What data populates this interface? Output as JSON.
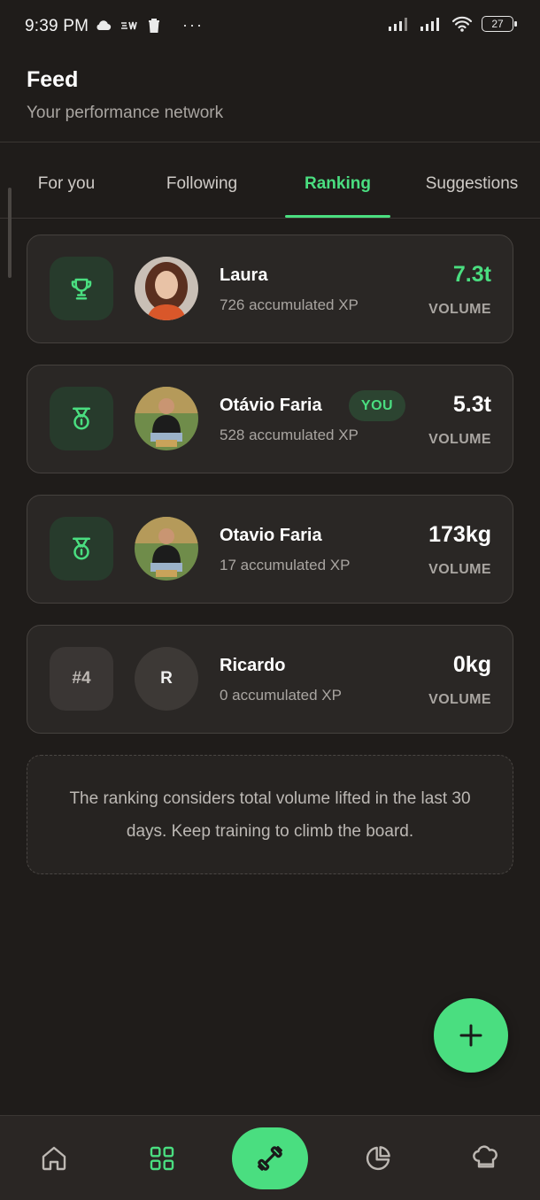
{
  "status_bar": {
    "time": "9:39 PM",
    "battery": "27",
    "dots": "···",
    "icons": [
      "cloud-icon",
      "notification-app-icon",
      "trash-icon",
      "cell-signal-icon",
      "cell-signal-icon",
      "wifi-icon",
      "battery-icon"
    ]
  },
  "header": {
    "title": "Feed",
    "subtitle": "Your performance network"
  },
  "tabs": [
    {
      "label": "For you",
      "active": false
    },
    {
      "label": "Following",
      "active": false
    },
    {
      "label": "Ranking",
      "active": true
    },
    {
      "label": "Suggestions",
      "active": false
    }
  ],
  "ranking": [
    {
      "name": "Laura",
      "xp": "726 accumulated XP",
      "volume": "7.3t",
      "volume_label": "VOLUME",
      "badge_icon": "trophy-icon",
      "highlight": true
    },
    {
      "name": "Otávio Faria",
      "xp": "528 accumulated XP",
      "volume": "5.3t",
      "volume_label": "VOLUME",
      "badge_icon": "medal-icon",
      "you_label": "YOU"
    },
    {
      "name": "Otavio Faria",
      "xp": "17 accumulated XP",
      "volume": "173kg",
      "volume_label": "VOLUME",
      "badge_icon": "medal-icon"
    },
    {
      "name": "Ricardo",
      "xp": "0 accumulated XP",
      "volume": "0kg",
      "volume_label": "VOLUME",
      "rank": "#4",
      "initial": "R"
    }
  ],
  "info_text": "The ranking considers total volume lifted in the last 30 days. Keep training to climb the board.",
  "fab_icon": "plus-icon",
  "bottom_nav": [
    "home-icon",
    "grid-icon",
    "dumbbell-icon",
    "pie-chart-icon",
    "chef-hat-icon"
  ],
  "colors": {
    "accent": "#4ade80",
    "background": "#1f1c1a",
    "card": "#2a2725"
  }
}
